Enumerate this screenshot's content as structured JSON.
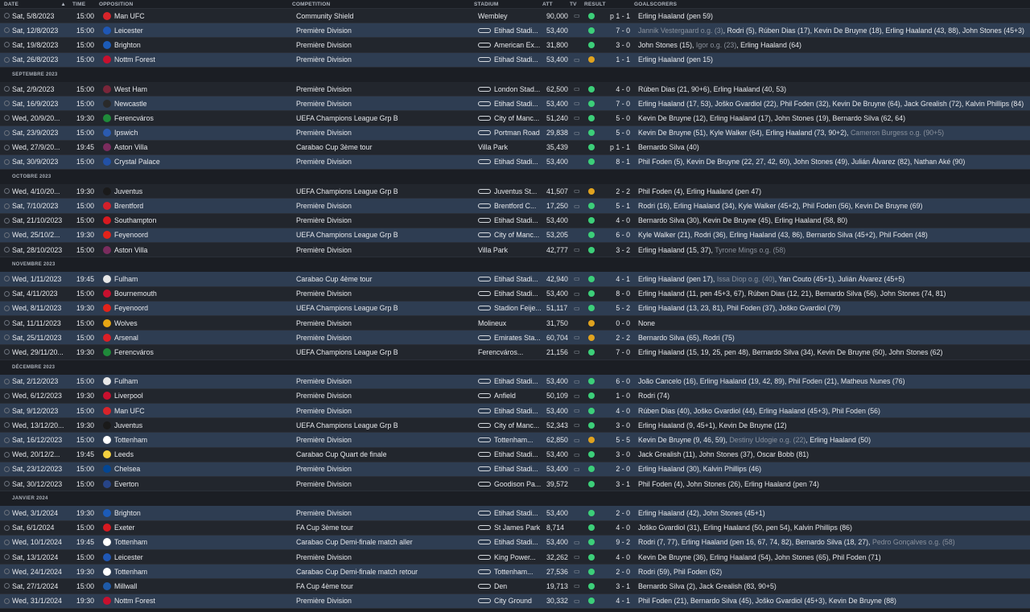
{
  "columns": {
    "date": "DATE",
    "time": "TIME",
    "opposition": "OPPOSITION",
    "competition": "COMPETITION",
    "stadium": "STADIUM",
    "att": "ATT",
    "tv": "TV",
    "result": "RESULT",
    "goalscorers": "GOALSCORERS"
  },
  "colors": {
    "win": "#3ccf79",
    "draw": "#e0a31f",
    "odd_row": "#2e3d52",
    "even_row": "#22262d"
  },
  "rows": [
    {
      "type": "match",
      "date": "Sat, 5/8/2023",
      "time": "15:00",
      "opp": "Man UFC",
      "crest": "#d8242a",
      "comp": "Community Shield",
      "stadium": "Wembley",
      "stad_icon": false,
      "att": "90,000",
      "tv": true,
      "result": "p 1 - 1",
      "outcome": "win",
      "goals": [
        {
          "t": "Erling Haaland (pen 59)"
        }
      ]
    },
    {
      "type": "match",
      "date": "Sat, 12/8/2023",
      "time": "15:00",
      "opp": "Leicester",
      "crest": "#1f57b5",
      "comp": "Première Division",
      "stadium": "Etihad Stadi...",
      "stad_icon": true,
      "att": "53,400",
      "tv": false,
      "result": "7 - 0",
      "outcome": "win",
      "goals": [
        {
          "t": "Jannik Vestergaard o.g. (3)",
          "og": true
        },
        {
          "t": ", Rodri (5), Rúben Dias (17), Kevin De Bruyne (18), Erling Haaland (43, 88), John Stones (45+3)"
        }
      ]
    },
    {
      "type": "match",
      "date": "Sat, 19/8/2023",
      "time": "15:00",
      "opp": "Brighton",
      "crest": "#1c5bb8",
      "comp": "Première Division",
      "stadium": "American Ex...",
      "stad_icon": true,
      "att": "31,800",
      "tv": false,
      "result": "3 - 0",
      "outcome": "win",
      "goals": [
        {
          "t": "John Stones (15), "
        },
        {
          "t": "Igor o.g. (23)",
          "og": true
        },
        {
          "t": ", Erling Haaland (64)"
        }
      ]
    },
    {
      "type": "match",
      "date": "Sat, 26/8/2023",
      "time": "15:00",
      "opp": "Nottm Forest",
      "crest": "#c8102e",
      "comp": "Première Division",
      "stadium": "Etihad Stadi...",
      "stad_icon": true,
      "att": "53,400",
      "tv": true,
      "result": "1 - 1",
      "outcome": "draw",
      "goals": [
        {
          "t": "Erling Haaland (pen 15)"
        }
      ]
    },
    {
      "type": "month",
      "label": "SEPTEMBRE 2023"
    },
    {
      "type": "match",
      "date": "Sat, 2/9/2023",
      "time": "15:00",
      "opp": "West Ham",
      "crest": "#7a263a",
      "comp": "Première Division",
      "stadium": "London Stad...",
      "stad_icon": true,
      "att": "62,500",
      "tv": true,
      "result": "4 - 0",
      "outcome": "win",
      "goals": [
        {
          "t": "Rúben Dias (21, 90+6), Erling Haaland (40, 53)"
        }
      ]
    },
    {
      "type": "match",
      "date": "Sat, 16/9/2023",
      "time": "15:00",
      "opp": "Newcastle",
      "crest": "#2a2a2a",
      "comp": "Première Division",
      "stadium": "Etihad Stadi...",
      "stad_icon": true,
      "att": "53,400",
      "tv": true,
      "result": "7 - 0",
      "outcome": "win",
      "goals": [
        {
          "t": "Erling Haaland (17, 53), Joško Gvardiol (22), Phil Foden (32), Kevin De Bruyne (64), Jack Grealish (72), Kalvin Phillips (84)"
        }
      ]
    },
    {
      "type": "match",
      "date": "Wed, 20/9/20...",
      "time": "19:30",
      "opp": "Ferencváros",
      "crest": "#1f8a3a",
      "comp": "UEFA Champions League Grp B",
      "stadium": "City of Manc...",
      "stad_icon": true,
      "att": "51,240",
      "tv": true,
      "result": "5 - 0",
      "outcome": "win",
      "goals": [
        {
          "t": "Kevin De Bruyne (12), Erling Haaland (17), John Stones (19), Bernardo Silva (62, 64)"
        }
      ]
    },
    {
      "type": "match",
      "date": "Sat, 23/9/2023",
      "time": "15:00",
      "opp": "Ipswich",
      "crest": "#2b5bb0",
      "comp": "Première Division",
      "stadium": "Portman Road",
      "stad_icon": true,
      "att": "29,838",
      "tv": true,
      "result": "5 - 0",
      "outcome": "win",
      "goals": [
        {
          "t": "Kevin De Bruyne (51), Kyle Walker (64), Erling Haaland (73, 90+2), "
        },
        {
          "t": "Cameron Burgess o.g. (90+5)",
          "og": true
        }
      ]
    },
    {
      "type": "match",
      "date": "Wed, 27/9/20...",
      "time": "19:45",
      "opp": "Aston Villa",
      "crest": "#7b2c5e",
      "comp": "Carabao Cup 3ème tour",
      "stadium": "Villa Park",
      "stad_icon": false,
      "att": "35,439",
      "tv": false,
      "result": "p 1 - 1",
      "outcome": "win",
      "goals": [
        {
          "t": "Bernardo Silva (40)"
        }
      ]
    },
    {
      "type": "match",
      "date": "Sat, 30/9/2023",
      "time": "15:00",
      "opp": "Crystal Palace",
      "crest": "#2251a6",
      "comp": "Première Division",
      "stadium": "Etihad Stadi...",
      "stad_icon": true,
      "att": "53,400",
      "tv": false,
      "result": "8 - 1",
      "outcome": "win",
      "goals": [
        {
          "t": "Phil Foden (5), Kevin De Bruyne (22, 27, 42, 60), John Stones (49), Julián Álvarez (82), Nathan Aké (90)"
        }
      ]
    },
    {
      "type": "month",
      "label": "OCTOBRE 2023"
    },
    {
      "type": "match",
      "date": "Wed, 4/10/20...",
      "time": "19:30",
      "opp": "Juventus",
      "crest": "#1a1a1a",
      "comp": "UEFA Champions League Grp B",
      "stadium": "Juventus St...",
      "stad_icon": true,
      "att": "41,507",
      "tv": true,
      "result": "2 - 2",
      "outcome": "draw",
      "goals": [
        {
          "t": "Phil Foden (4), Erling Haaland (pen 47)"
        }
      ]
    },
    {
      "type": "match",
      "date": "Sat, 7/10/2023",
      "time": "15:00",
      "opp": "Brentford",
      "crest": "#d4202a",
      "comp": "Première Division",
      "stadium": "Brentford C...",
      "stad_icon": true,
      "att": "17,250",
      "tv": true,
      "result": "5 - 1",
      "outcome": "win",
      "goals": [
        {
          "t": "Rodri (16), Erling Haaland (34), Kyle Walker (45+2), Phil Foden (56), Kevin De Bruyne (69)"
        }
      ]
    },
    {
      "type": "match",
      "date": "Sat, 21/10/2023",
      "time": "15:00",
      "opp": "Southampton",
      "crest": "#d71920",
      "comp": "Première Division",
      "stadium": "Etihad Stadi...",
      "stad_icon": true,
      "att": "53,400",
      "tv": false,
      "result": "4 - 0",
      "outcome": "win",
      "goals": [
        {
          "t": "Bernardo Silva (30), Kevin De Bruyne (45), Erling Haaland (58, 80)"
        }
      ]
    },
    {
      "type": "match",
      "date": "Wed, 25/10/2...",
      "time": "19:30",
      "opp": "Feyenoord",
      "crest": "#e2231a",
      "comp": "UEFA Champions League Grp B",
      "stadium": "City of Manc...",
      "stad_icon": true,
      "att": "53,205",
      "tv": false,
      "result": "6 - 0",
      "outcome": "win",
      "goals": [
        {
          "t": "Kyle Walker (21), Rodri (36), Erling Haaland (43, 86), Bernardo Silva (45+2), Phil Foden (48)"
        }
      ]
    },
    {
      "type": "match",
      "date": "Sat, 28/10/2023",
      "time": "15:00",
      "opp": "Aston Villa",
      "crest": "#7b2c5e",
      "comp": "Première Division",
      "stadium": "Villa Park",
      "stad_icon": false,
      "att": "42,777",
      "tv": true,
      "result": "3 - 2",
      "outcome": "win",
      "goals": [
        {
          "t": "Erling Haaland (15, 37), "
        },
        {
          "t": "Tyrone Mings o.g. (58)",
          "og": true
        }
      ]
    },
    {
      "type": "month",
      "label": "NOVEMBRE 2023"
    },
    {
      "type": "match",
      "date": "Wed, 1/11/2023",
      "time": "19:45",
      "opp": "Fulham",
      "crest": "#e8e8e8",
      "comp": "Carabao Cup 4ème tour",
      "stadium": "Etihad Stadi...",
      "stad_icon": true,
      "att": "42,940",
      "tv": true,
      "result": "4 - 1",
      "outcome": "win",
      "goals": [
        {
          "t": "Erling Haaland (pen 17), "
        },
        {
          "t": "Issa Diop o.g. (40)",
          "og": true
        },
        {
          "t": ", Yan Couto (45+1), Julián Álvarez (45+5)"
        }
      ]
    },
    {
      "type": "match",
      "date": "Sat, 4/11/2023",
      "time": "15:00",
      "opp": "Bournemouth",
      "crest": "#c8102e",
      "comp": "Première Division",
      "stadium": "Etihad Stadi...",
      "stad_icon": true,
      "att": "53,400",
      "tv": true,
      "result": "8 - 0",
      "outcome": "win",
      "goals": [
        {
          "t": "Erling Haaland (11, pen 45+3, 67), Rúben Dias (12, 21), Bernardo Silva (56), John Stones (74, 81)"
        }
      ]
    },
    {
      "type": "match",
      "date": "Wed, 8/11/2023",
      "time": "19:30",
      "opp": "Feyenoord",
      "crest": "#e2231a",
      "comp": "UEFA Champions League Grp B",
      "stadium": "Stadion Feije...",
      "stad_icon": true,
      "att": "51,117",
      "tv": true,
      "result": "5 - 2",
      "outcome": "win",
      "goals": [
        {
          "t": "Erling Haaland (13, 23, 81), Phil Foden (37), Joško Gvardiol (79)"
        }
      ]
    },
    {
      "type": "match",
      "date": "Sat, 11/11/2023",
      "time": "15:00",
      "opp": "Wolves",
      "crest": "#e7a614",
      "comp": "Première Division",
      "stadium": "Molineux",
      "stad_icon": false,
      "att": "31,750",
      "tv": false,
      "result": "0 - 0",
      "outcome": "draw",
      "goals": [
        {
          "t": "None"
        }
      ]
    },
    {
      "type": "match",
      "date": "Sat, 25/11/2023",
      "time": "15:00",
      "opp": "Arsenal",
      "crest": "#db1f26",
      "comp": "Première Division",
      "stadium": "Emirates Sta...",
      "stad_icon": true,
      "att": "60,704",
      "tv": true,
      "result": "2 - 2",
      "outcome": "draw",
      "goals": [
        {
          "t": "Bernardo Silva (65), Rodri (75)"
        }
      ]
    },
    {
      "type": "match",
      "date": "Wed, 29/11/20...",
      "time": "19:30",
      "opp": "Ferencváros",
      "crest": "#1f8a3a",
      "comp": "UEFA Champions League Grp B",
      "stadium": "Ferencváros...",
      "stad_icon": false,
      "att": "21,156",
      "tv": true,
      "result": "7 - 0",
      "outcome": "win",
      "goals": [
        {
          "t": "Erling Haaland (15, 19, 25, pen 48), Bernardo Silva (34), Kevin De Bruyne (50), John Stones (62)"
        }
      ]
    },
    {
      "type": "month",
      "label": "DÉCEMBRE 2023"
    },
    {
      "type": "match",
      "date": "Sat, 2/12/2023",
      "time": "15:00",
      "opp": "Fulham",
      "crest": "#e8e8e8",
      "comp": "Première Division",
      "stadium": "Etihad Stadi...",
      "stad_icon": true,
      "att": "53,400",
      "tv": true,
      "result": "6 - 0",
      "outcome": "win",
      "goals": [
        {
          "t": "João Cancelo (16), Erling Haaland (19, 42, 89), Phil Foden (21), Matheus Nunes (76)"
        }
      ]
    },
    {
      "type": "match",
      "date": "Wed, 6/12/2023",
      "time": "19:30",
      "opp": "Liverpool",
      "crest": "#c8102e",
      "comp": "Première Division",
      "stadium": "Anfield",
      "stad_icon": true,
      "att": "50,109",
      "tv": true,
      "result": "1 - 0",
      "outcome": "win",
      "goals": [
        {
          "t": "Rodri (74)"
        }
      ]
    },
    {
      "type": "match",
      "date": "Sat, 9/12/2023",
      "time": "15:00",
      "opp": "Man UFC",
      "crest": "#d8242a",
      "comp": "Première Division",
      "stadium": "Etihad Stadi...",
      "stad_icon": true,
      "att": "53,400",
      "tv": true,
      "result": "4 - 0",
      "outcome": "win",
      "goals": [
        {
          "t": "Rúben Dias (40), Joško Gvardiol (44), Erling Haaland (45+3), Phil Foden (56)"
        }
      ]
    },
    {
      "type": "match",
      "date": "Wed, 13/12/20...",
      "time": "19:30",
      "opp": "Juventus",
      "crest": "#1a1a1a",
      "comp": "UEFA Champions League Grp B",
      "stadium": "City of Manc...",
      "stad_icon": true,
      "att": "52,343",
      "tv": true,
      "result": "3 - 0",
      "outcome": "win",
      "goals": [
        {
          "t": "Erling Haaland (9, 45+1), Kevin De Bruyne (12)"
        }
      ]
    },
    {
      "type": "match",
      "date": "Sat, 16/12/2023",
      "time": "15:00",
      "opp": "Tottenham",
      "crest": "#ffffff",
      "comp": "Première Division",
      "stadium": "Tottenham...",
      "stad_icon": true,
      "att": "62,850",
      "tv": true,
      "result": "5 - 5",
      "outcome": "draw",
      "goals": [
        {
          "t": "Kevin De Bruyne (9, 46, 59), "
        },
        {
          "t": "Destiny Udogie o.g. (22)",
          "og": true
        },
        {
          "t": ", Erling Haaland (50)"
        }
      ]
    },
    {
      "type": "match",
      "date": "Wed, 20/12/2...",
      "time": "19:45",
      "opp": "Leeds",
      "crest": "#f4d03f",
      "comp": "Carabao Cup Quart de finale",
      "stadium": "Etihad Stadi...",
      "stad_icon": true,
      "att": "53,400",
      "tv": true,
      "result": "3 - 0",
      "outcome": "win",
      "goals": [
        {
          "t": "Jack Grealish (11), John Stones (37), Oscar Bobb (81)"
        }
      ]
    },
    {
      "type": "match",
      "date": "Sat, 23/12/2023",
      "time": "15:00",
      "opp": "Chelsea",
      "crest": "#034694",
      "comp": "Première Division",
      "stadium": "Etihad Stadi...",
      "stad_icon": true,
      "att": "53,400",
      "tv": true,
      "result": "2 - 0",
      "outcome": "win",
      "goals": [
        {
          "t": "Erling Haaland (30), Kalvin Phillips (46)"
        }
      ]
    },
    {
      "type": "match",
      "date": "Sat, 30/12/2023",
      "time": "15:00",
      "opp": "Everton",
      "crest": "#274488",
      "comp": "Première Division",
      "stadium": "Goodison Pa...",
      "stad_icon": true,
      "att": "39,572",
      "tv": false,
      "result": "3 - 1",
      "outcome": "win",
      "goals": [
        {
          "t": "Phil Foden (4), John Stones (26), Erling Haaland (pen 74)"
        }
      ]
    },
    {
      "type": "month",
      "label": "JANVIER 2024"
    },
    {
      "type": "match",
      "date": "Wed, 3/1/2024",
      "time": "19:30",
      "opp": "Brighton",
      "crest": "#1c5bb8",
      "comp": "Première Division",
      "stadium": "Etihad Stadi...",
      "stad_icon": true,
      "att": "53,400",
      "tv": false,
      "result": "2 - 0",
      "outcome": "win",
      "goals": [
        {
          "t": "Erling Haaland (42), John Stones (45+1)"
        }
      ]
    },
    {
      "type": "match",
      "date": "Sat, 6/1/2024",
      "time": "15:00",
      "opp": "Exeter",
      "crest": "#d71920",
      "comp": "FA Cup 3ème tour",
      "stadium": "St James Park",
      "stad_icon": true,
      "att": "8,714",
      "tv": false,
      "result": "4 - 0",
      "outcome": "win",
      "goals": [
        {
          "t": "Joško Gvardiol (31), Erling Haaland (50, pen 54), Kalvin Phillips (86)"
        }
      ]
    },
    {
      "type": "match",
      "date": "Wed, 10/1/2024",
      "time": "19:45",
      "opp": "Tottenham",
      "crest": "#ffffff",
      "comp": "Carabao Cup Demi-finale match aller",
      "stadium": "Etihad Stadi...",
      "stad_icon": true,
      "att": "53,400",
      "tv": true,
      "result": "9 - 2",
      "outcome": "win",
      "goals": [
        {
          "t": "Rodri (7, 77), Erling Haaland (pen 16, 67, 74, 82), Bernardo Silva (18, 27), "
        },
        {
          "t": "Pedro Gonçalves o.g. (58)",
          "og": true
        }
      ]
    },
    {
      "type": "match",
      "date": "Sat, 13/1/2024",
      "time": "15:00",
      "opp": "Leicester",
      "crest": "#1f57b5",
      "comp": "Première Division",
      "stadium": "King Power...",
      "stad_icon": true,
      "att": "32,262",
      "tv": true,
      "result": "4 - 0",
      "outcome": "win",
      "goals": [
        {
          "t": "Kevin De Bruyne (36), Erling Haaland (54), John Stones (65), Phil Foden (71)"
        }
      ]
    },
    {
      "type": "match",
      "date": "Wed, 24/1/2024",
      "time": "19:30",
      "opp": "Tottenham",
      "crest": "#ffffff",
      "comp": "Carabao Cup Demi-finale match retour",
      "stadium": "Tottenham...",
      "stad_icon": true,
      "att": "27,536",
      "tv": true,
      "result": "2 - 0",
      "outcome": "win",
      "goals": [
        {
          "t": "Rodri (59), Phil Foden (62)"
        }
      ]
    },
    {
      "type": "match",
      "date": "Sat, 27/1/2024",
      "time": "15:00",
      "opp": "Millwall",
      "crest": "#1e5aa8",
      "comp": "FA Cup 4ème tour",
      "stadium": "Den",
      "stad_icon": true,
      "att": "19,713",
      "tv": true,
      "result": "3 - 1",
      "outcome": "win",
      "goals": [
        {
          "t": "Bernardo Silva (2), Jack Grealish (83, 90+5)"
        }
      ]
    },
    {
      "type": "match",
      "date": "Wed, 31/1/2024",
      "time": "19:30",
      "opp": "Nottm Forest",
      "crest": "#c8102e",
      "comp": "Première Division",
      "stadium": "City Ground",
      "stad_icon": true,
      "att": "30,332",
      "tv": true,
      "result": "4 - 1",
      "outcome": "win",
      "goals": [
        {
          "t": "Phil Foden (21), Bernardo Silva (45), Joško Gvardiol (45+3), Kevin De Bruyne (88)"
        }
      ]
    }
  ]
}
